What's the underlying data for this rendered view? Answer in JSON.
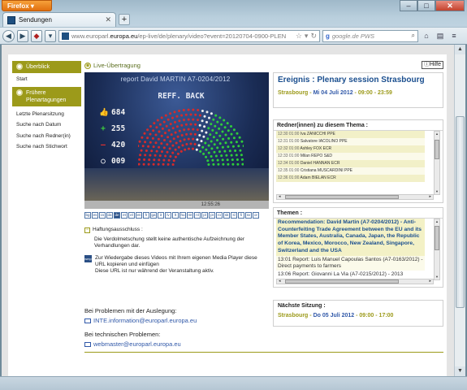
{
  "browser": {
    "app_button": "Firefox",
    "tab_title": "Sendungen",
    "url_prefix": "www.europarl.",
    "url_domain": "europa.eu",
    "url_rest": "/ep-live/de/plenary/video?event=20120704-0900-PLEN",
    "search_placeholder": "google.de PWS",
    "icons": [
      "back-icon",
      "forward-icon",
      "addon-icon",
      "site-icon",
      "bookmark-star-icon",
      "reload-icon",
      "google-icon",
      "search-icon",
      "home-icon",
      "bookmarks-icon",
      "menu-icon"
    ]
  },
  "leftnav": {
    "section1": "Überblick",
    "section1_items": [
      "Start"
    ],
    "section2": "Frühere Plenartagungen",
    "section2_items": [
      "Letzte Plenarsitzung",
      "Suche nach Datum",
      "Suche nach Redner(in)",
      "Suche nach Stichwort"
    ]
  },
  "live": {
    "title": "Live-Übertragung",
    "help": "Hilfe"
  },
  "video": {
    "report": "report David MARTIN A7-0204/2012",
    "vote_title": "REFF. BACK",
    "tallies": [
      {
        "symbol": "👍",
        "value": "684"
      },
      {
        "symbol": "+",
        "value": "255"
      },
      {
        "symbol": "—",
        "value": "420"
      },
      {
        "symbol": "○",
        "value": "009"
      }
    ],
    "timecode": "12:55:26",
    "languages": [
      "bg",
      "es",
      "cs",
      "da",
      "de",
      "et",
      "el",
      "en",
      "fr",
      "ga",
      "it",
      "lv",
      "lt",
      "hu",
      "mt",
      "nl",
      "pl",
      "pt",
      "ro",
      "sk",
      "sl",
      "fi",
      "sv",
      "or"
    ],
    "active_language": "de"
  },
  "notes": {
    "disclaimer_title": "Haftungsausschluss :",
    "disclaimer_text": "Die Verdolmetschung stellt keine authentische Aufzeichnung der Verhandlungen dar.",
    "player_text": "Zur Wiedergabe dieses Videos mit Ihrem eigenen Media Player diese URL kopieren und einfügen",
    "player_note": "Diese URL ist nur während der Veranstaltung aktiv."
  },
  "contacts": {
    "q1": "Bei Problemen mit der Auslegung:",
    "mail1": "INTE.information@europarl.europa.eu",
    "q2": "Bei technischen Problemen:",
    "mail2": "webmaster@europarl.europa.eu"
  },
  "event": {
    "title": "Ereignis : Plenary session Strasbourg",
    "location": "Strasbourg",
    "date": "Mi 04 Juli 2012",
    "start": "09:00",
    "end": "23:59"
  },
  "speakers": {
    "title": "Redner(innen) zu diesem Thema :",
    "rows": [
      {
        "time": "12:30 01:00",
        "name": "Iva ZANICCHI PPE"
      },
      {
        "time": "12:31 01:00",
        "name": "Salvatore IACOLINO PPE"
      },
      {
        "time": "12:32 01:00",
        "name": "Ashley FOX ECR"
      },
      {
        "time": "12:33 01:00",
        "name": "Milan REPO S&D"
      },
      {
        "time": "12:34 01:00",
        "name": "Daniel HANNAN ECR"
      },
      {
        "time": "12:35 01:00",
        "name": "Cristiana MUSCARDINI PPE"
      },
      {
        "time": "12:36 01:00",
        "name": "Adam BIELAN ECR"
      }
    ]
  },
  "themen": {
    "title": "Themen :",
    "main": "Recommendation: David Martin (A7-0204/2012) - Anti-Counterfeiting Trade Agreement between the EU and its Member States, Australia, Canada, Japan, the Republic of Korea, Mexico, Morocco, New Zealand, Singapore, Switzerland and the USA",
    "items": [
      "13:01 Report: Luis Manuel Capoulas Santos (A7-0163/2012) - Direct payments to farmers",
      "13:06 Report: Giovanni La Via (A7-0215/2012) - 2013"
    ]
  },
  "next": {
    "title": "Nächste Sitzung :",
    "location": "Strasbourg",
    "date": "Do 05 Juli 2012",
    "start": "09:00",
    "end": "17:00"
  }
}
